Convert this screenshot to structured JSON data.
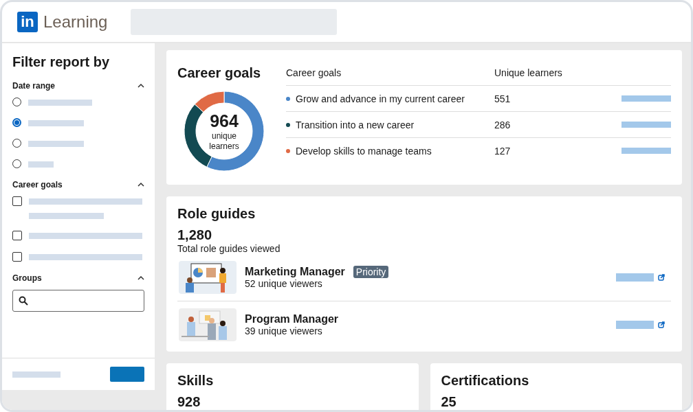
{
  "header": {
    "logo_mark": "in",
    "logo_text": "Learning"
  },
  "sidebar": {
    "title": "Filter report by",
    "sections": [
      {
        "label": "Date range",
        "expanded": true,
        "kind": "radio",
        "options": [
          {
            "selected": false
          },
          {
            "selected": true
          },
          {
            "selected": false
          },
          {
            "selected": false
          }
        ]
      },
      {
        "label": "Career goals",
        "expanded": true,
        "kind": "checkbox",
        "options": [
          {
            "checked": false
          },
          {
            "checked": false
          },
          {
            "checked": false
          }
        ]
      },
      {
        "label": "Groups",
        "expanded": true,
        "kind": "search"
      }
    ]
  },
  "career_goals": {
    "title": "Career goals",
    "total": "964",
    "total_label": "unique learners",
    "columns": [
      "Career goals",
      "Unique learners"
    ],
    "rows": [
      {
        "goal": "Grow and advance in my current career",
        "count": "551",
        "color": "#4a86c8"
      },
      {
        "goal": "Transition into a new career",
        "count": "286",
        "color": "#134a52"
      },
      {
        "goal": "Develop skills to manage teams",
        "count": "127",
        "color": "#e06a45"
      }
    ]
  },
  "role_guides": {
    "title": "Role guides",
    "total": "1,280",
    "total_label": "Total role guides viewed",
    "items": [
      {
        "name": "Marketing Manager",
        "badge": "Priority",
        "viewers": "52 unique viewers",
        "kind": "presentation"
      },
      {
        "name": "Program Manager",
        "viewers": "39 unique viewers",
        "kind": "meeting"
      }
    ]
  },
  "bottom_cards": [
    {
      "title": "Skills",
      "value": "928"
    },
    {
      "title": "Certifications",
      "value": "25"
    }
  ]
}
